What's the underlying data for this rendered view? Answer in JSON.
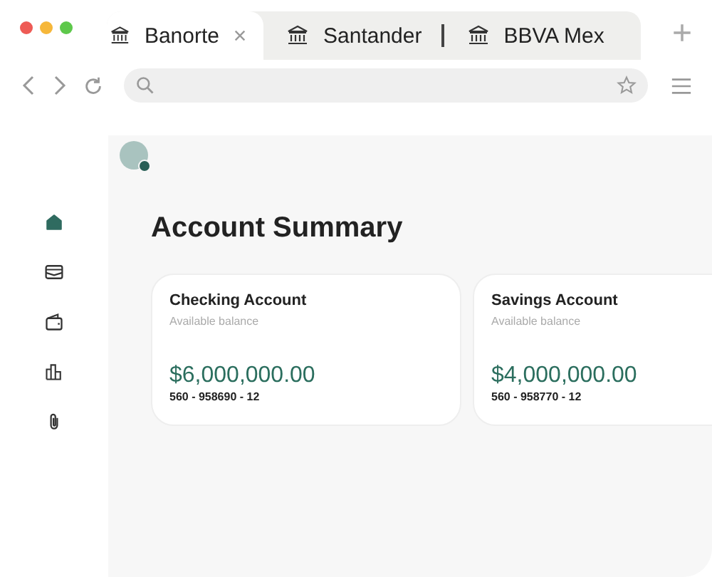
{
  "tabs": [
    {
      "label": "Banorte",
      "selected": true,
      "closable": true
    },
    {
      "label": "Santander",
      "selected": false,
      "closable": false
    },
    {
      "label": "BBVA Mex",
      "selected": false,
      "closable": false
    }
  ],
  "new_tab": "+",
  "sidebar": {
    "items": [
      {
        "kind": "home",
        "selected": true
      },
      {
        "kind": "inbox",
        "selected": false
      },
      {
        "kind": "wallet",
        "selected": false
      },
      {
        "kind": "chart",
        "selected": false
      },
      {
        "kind": "attachment",
        "selected": false
      }
    ]
  },
  "heading": "Account Summary",
  "accounts": [
    {
      "name": "Checking Account",
      "caption": "Available balance",
      "balance": "$6,000,000.00",
      "number": "560 - 958690 - 12"
    },
    {
      "name": "Savings Account",
      "caption": "Available balance",
      "balance": "$4,000,000.00",
      "number": "560 - 958770 - 12"
    }
  ]
}
